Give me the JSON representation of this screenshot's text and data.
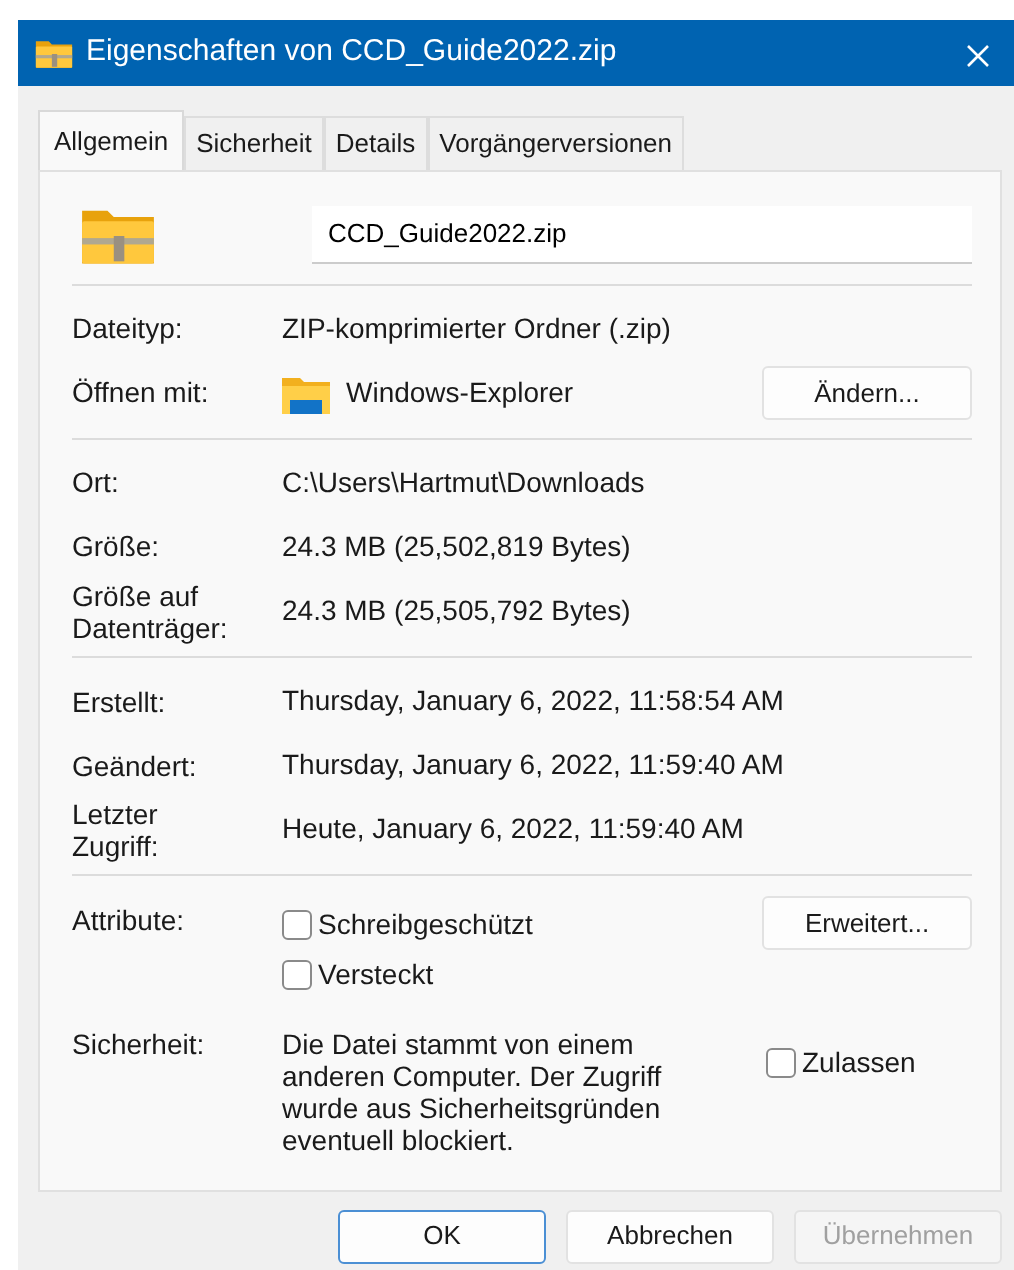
{
  "window": {
    "title": "Eigenschaften von CCD_Guide2022.zip"
  },
  "tabs": [
    {
      "label": "Allgemein",
      "selected": true
    },
    {
      "label": "Sicherheit",
      "selected": false
    },
    {
      "label": "Details",
      "selected": false
    },
    {
      "label": "Vorgängerversionen",
      "selected": false
    }
  ],
  "file_name": "CCD_Guide2022.zip",
  "sections": [
    [
      {
        "kind": "text",
        "label": "Dateityp:",
        "value": "ZIP-komprimierter Ordner (.zip)"
      },
      {
        "kind": "app",
        "label": "Öffnen mit:",
        "value": "Windows-Explorer",
        "button": "Ändern..."
      }
    ],
    [
      {
        "kind": "text",
        "label": "Ort:",
        "value": "C:\\Users\\Hartmut\\Downloads"
      },
      {
        "kind": "text",
        "label": "Größe:",
        "value": "24.3 MB (25,502,819 Bytes)"
      },
      {
        "kind": "text",
        "label": "Größe auf\nDatenträger:",
        "value": "24.3 MB (25,505,792 Bytes)"
      }
    ],
    [
      {
        "kind": "text",
        "label": "Erstellt:",
        "value": "Thursday, January 6, 2022, 11:58:54 AM"
      },
      {
        "kind": "text",
        "label": "Geändert:",
        "value": "Thursday, January 6, 2022, 11:59:40 AM"
      },
      {
        "kind": "text",
        "label": "Letzter\nZugriff:",
        "value": "Heute, January 6, 2022, 11:59:40 AM"
      }
    ]
  ],
  "attributes": {
    "label": "Attribute:",
    "checkboxes": [
      {
        "label": "Schreibgeschützt",
        "checked": false
      },
      {
        "label": "Versteckt",
        "checked": false
      }
    ],
    "button": "Erweitert..."
  },
  "security": {
    "label": "Sicherheit:",
    "text": "Die Datei stammt von einem anderen Computer. Der Zugriff wurde aus Sicherheitsgründen eventuell blockiert.",
    "checkbox": {
      "label": "Zulassen",
      "checked": false
    }
  },
  "buttons": [
    {
      "label": "OK",
      "default": true,
      "disabled": false
    },
    {
      "label": "Abbrechen",
      "default": false,
      "disabled": false
    },
    {
      "label": "Übernehmen",
      "default": false,
      "disabled": true
    }
  ]
}
